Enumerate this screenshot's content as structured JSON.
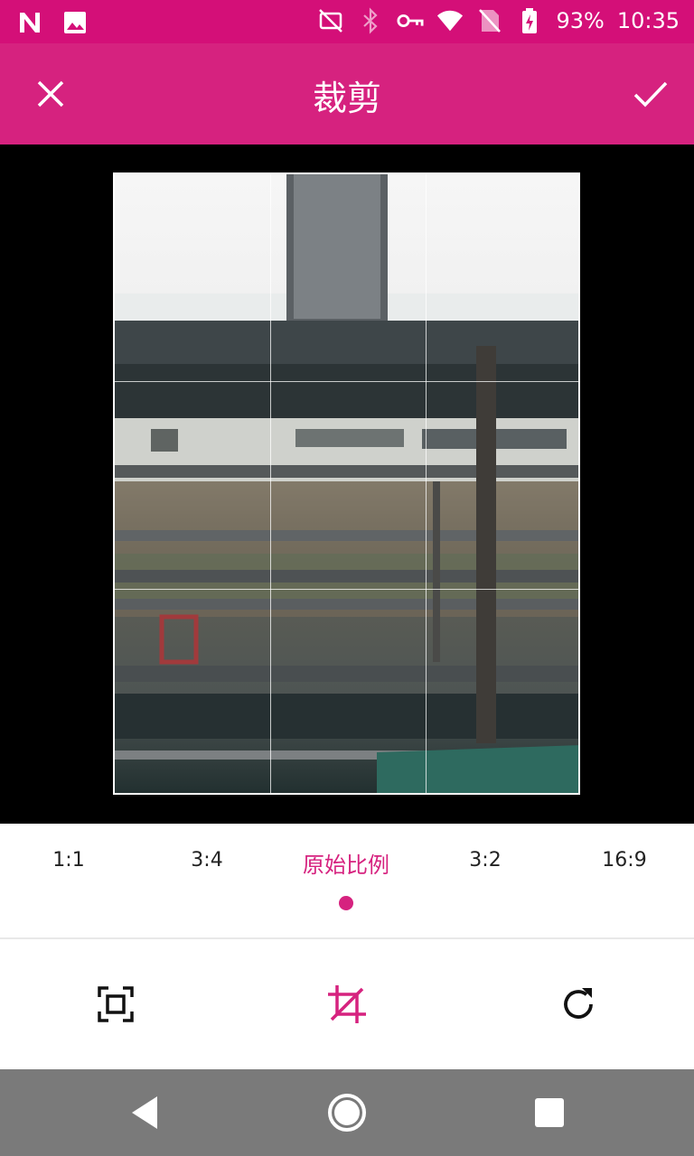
{
  "status_bar": {
    "battery": "93%",
    "time": "10:35",
    "icons": [
      "n-notification-icon",
      "image-notification-icon",
      "no-sim-icon",
      "bluetooth-icon",
      "vpn-key-icon",
      "wifi-icon",
      "sim-blocked-icon",
      "battery-charging-icon"
    ]
  },
  "toolbar": {
    "title": "裁剪",
    "close_icon": "close-icon",
    "confirm_icon": "check-icon"
  },
  "ratios": {
    "items": [
      "1:1",
      "3:4",
      "原始比例",
      "3:2",
      "16:9"
    ],
    "selected": "原始比例"
  },
  "tools": {
    "icons": [
      "fit-frame-icon",
      "crop-icon",
      "rotate-icon"
    ],
    "active": "crop-icon"
  },
  "nav": {
    "icons": [
      "back-icon",
      "home-icon",
      "recents-icon"
    ]
  },
  "colors": {
    "status_bar": "#d40f78",
    "toolbar": "#d6227f",
    "accent": "#d6227f",
    "nav_bar": "#7a7a7a"
  }
}
